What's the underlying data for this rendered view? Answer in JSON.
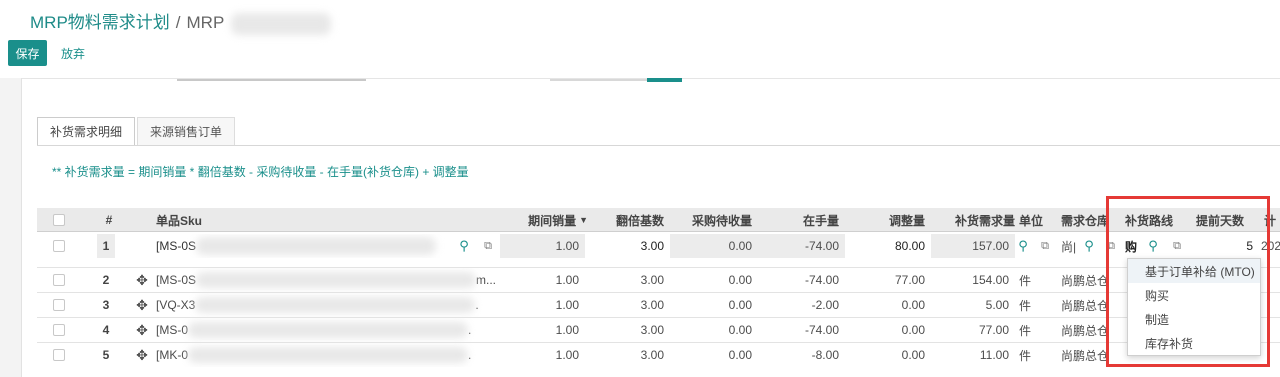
{
  "breadcrumb": {
    "parent": "MRP物料需求计划",
    "separator": "/",
    "current": "MRP"
  },
  "actions": {
    "save": "保存",
    "discard": "放弃"
  },
  "tabs": [
    {
      "label": "补货需求明细"
    },
    {
      "label": "来源销售订单"
    }
  ],
  "formula": "** 补货需求量 = 期间销量 * 翻倍基数 - 采购待收量 - 在手量(补货仓库) + 调整量",
  "columns": {
    "no": "#",
    "sku": "单品Sku",
    "period_sales": "期间销量",
    "multiplier": "翻倍基数",
    "purchase_pending": "采购待收量",
    "on_hand": "在手量",
    "adjust": "调整量",
    "required": "补货需求量",
    "unit": "单位",
    "warehouse": "需求仓库",
    "route": "补货路线",
    "lead_days": "提前天数",
    "plan": "计"
  },
  "sort_icon": "caret-down-icon",
  "rows": [
    {
      "no": "1",
      "sku": "[MS-0S",
      "period_sales": "1.00",
      "multiplier": "3.00",
      "purchase_pending": "0.00",
      "on_hand": "-74.00",
      "adjust": "80.00",
      "required": "157.00",
      "unit": "",
      "warehouse": "尚|",
      "route": "购",
      "lead_days": "5",
      "plan": "202"
    },
    {
      "no": "2",
      "sku": "[MS-0S",
      "sku_tail": "m...",
      "period_sales": "1.00",
      "multiplier": "3.00",
      "purchase_pending": "0.00",
      "on_hand": "-74.00",
      "adjust": "77.00",
      "required": "154.00",
      "unit": "件",
      "warehouse": "尚鹏总仓"
    },
    {
      "no": "3",
      "sku": "[VQ-X3",
      "sku_tail": ".",
      "period_sales": "1.00",
      "multiplier": "3.00",
      "purchase_pending": "0.00",
      "on_hand": "-2.00",
      "adjust": "0.00",
      "required": "5.00",
      "unit": "件",
      "warehouse": "尚鹏总仓"
    },
    {
      "no": "4",
      "sku": "[MS-0",
      "sku_tail": ".",
      "period_sales": "1.00",
      "multiplier": "3.00",
      "purchase_pending": "0.00",
      "on_hand": "-74.00",
      "adjust": "0.00",
      "required": "77.00",
      "unit": "件",
      "warehouse": "尚鹏总仓"
    },
    {
      "no": "5",
      "sku": "[MK-0",
      "sku_tail": ".",
      "period_sales": "1.00",
      "multiplier": "3.00",
      "purchase_pending": "0.00",
      "on_hand": "-8.00",
      "adjust": "0.00",
      "required": "11.00",
      "unit": "件",
      "warehouse": "尚鹏总仓"
    }
  ],
  "route_options": [
    "基于订单补给 (MTO)",
    "购买",
    "制造",
    "库存补货"
  ],
  "colors": {
    "accent": "#1a8f8b",
    "highlight_box": "#e53935"
  }
}
